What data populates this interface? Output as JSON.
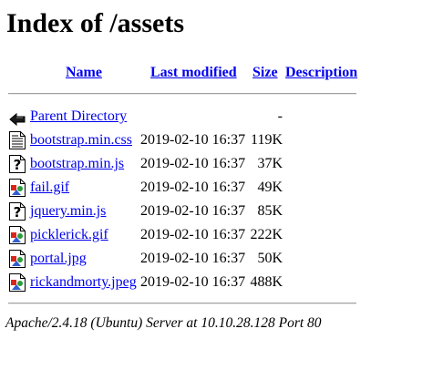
{
  "page": {
    "title": "Index of /assets"
  },
  "columns": {
    "name": "Name",
    "last_modified": "Last modified",
    "size": "Size",
    "description": "Description"
  },
  "parent": {
    "name": "Parent Directory",
    "size": "-",
    "icon": "back-icon"
  },
  "files": [
    {
      "name": "bootstrap.min.css",
      "modified": "2019-02-10 16:37",
      "size": "119K",
      "icon": "text-file-icon"
    },
    {
      "name": "bootstrap.min.js",
      "modified": "2019-02-10 16:37",
      "size": "37K",
      "icon": "unknown-file-icon"
    },
    {
      "name": "fail.gif",
      "modified": "2019-02-10 16:37",
      "size": "49K",
      "icon": "image-file-icon"
    },
    {
      "name": "jquery.min.js",
      "modified": "2019-02-10 16:37",
      "size": "85K",
      "icon": "unknown-file-icon"
    },
    {
      "name": "picklerick.gif",
      "modified": "2019-02-10 16:37",
      "size": "222K",
      "icon": "image-file-icon"
    },
    {
      "name": "portal.jpg",
      "modified": "2019-02-10 16:37",
      "size": "50K",
      "icon": "image-file-icon"
    },
    {
      "name": "rickandmorty.jpeg",
      "modified": "2019-02-10 16:37",
      "size": "488K",
      "icon": "image-file-icon"
    }
  ],
  "footer": {
    "address": "Apache/2.4.18 (Ubuntu) Server at 10.10.28.128 Port 80"
  }
}
